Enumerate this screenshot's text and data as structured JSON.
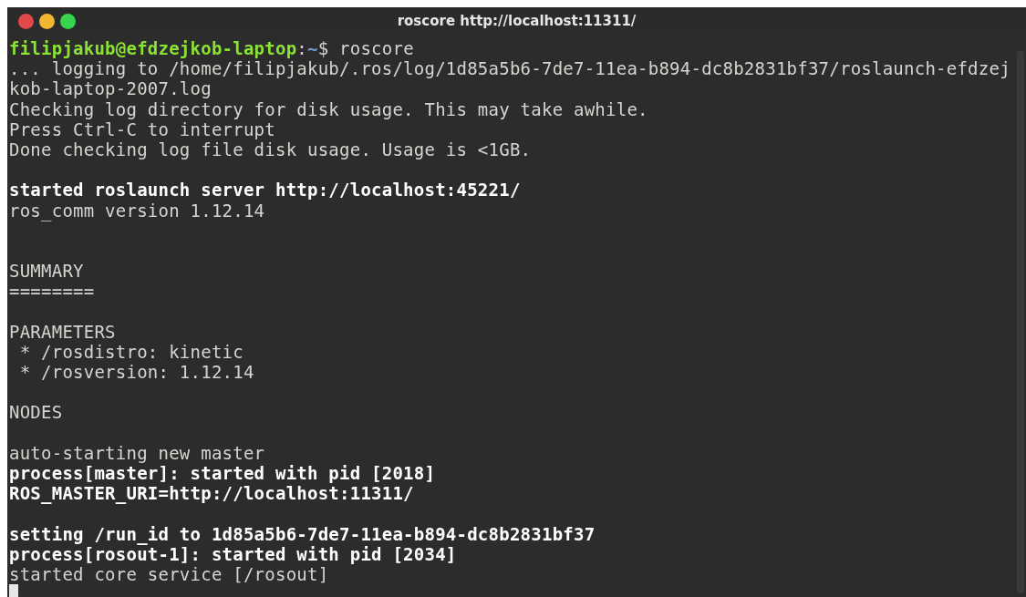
{
  "window": {
    "title": "roscore http://localhost:11311/"
  },
  "terminal": {
    "lines": [
      {
        "kind": "prompt",
        "segments": [
          {
            "kind": "user",
            "text": "filipjakub@efdzejkob-laptop"
          },
          {
            "kind": "plain",
            "text": ":"
          },
          {
            "kind": "path",
            "text": "~"
          },
          {
            "kind": "plain",
            "text": "$ roscore"
          }
        ]
      },
      {
        "kind": "normal",
        "text": "... logging to /home/filipjakub/.ros/log/1d85a5b6-7de7-11ea-b894-dc8b2831bf37/roslaunch-efdzej"
      },
      {
        "kind": "normal",
        "text": "kob-laptop-2007.log"
      },
      {
        "kind": "normal",
        "text": "Checking log directory for disk usage. This may take awhile."
      },
      {
        "kind": "normal",
        "text": "Press Ctrl-C to interrupt"
      },
      {
        "kind": "normal",
        "text": "Done checking log file disk usage. Usage is <1GB."
      },
      {
        "kind": "blank"
      },
      {
        "kind": "bold",
        "text": "started roslaunch server http://localhost:45221/"
      },
      {
        "kind": "normal",
        "text": "ros_comm version 1.12.14"
      },
      {
        "kind": "blank"
      },
      {
        "kind": "blank"
      },
      {
        "kind": "normal",
        "text": "SUMMARY"
      },
      {
        "kind": "normal",
        "text": "========"
      },
      {
        "kind": "blank"
      },
      {
        "kind": "normal",
        "text": "PARAMETERS"
      },
      {
        "kind": "normal",
        "text": " * /rosdistro: kinetic"
      },
      {
        "kind": "normal",
        "text": " * /rosversion: 1.12.14"
      },
      {
        "kind": "blank"
      },
      {
        "kind": "normal",
        "text": "NODES"
      },
      {
        "kind": "blank"
      },
      {
        "kind": "normal",
        "text": "auto-starting new master"
      },
      {
        "kind": "bold",
        "text": "process[master]: started with pid [2018]"
      },
      {
        "kind": "bold",
        "text": "ROS_MASTER_URI=http://localhost:11311/"
      },
      {
        "kind": "blank"
      },
      {
        "kind": "bold",
        "text": "setting /run_id to 1d85a5b6-7de7-11ea-b894-dc8b2831bf37"
      },
      {
        "kind": "bold",
        "text": "process[rosout-1]: started with pid [2034]"
      },
      {
        "kind": "normal",
        "text": "started core service [/rosout]"
      },
      {
        "kind": "cursor"
      }
    ]
  }
}
